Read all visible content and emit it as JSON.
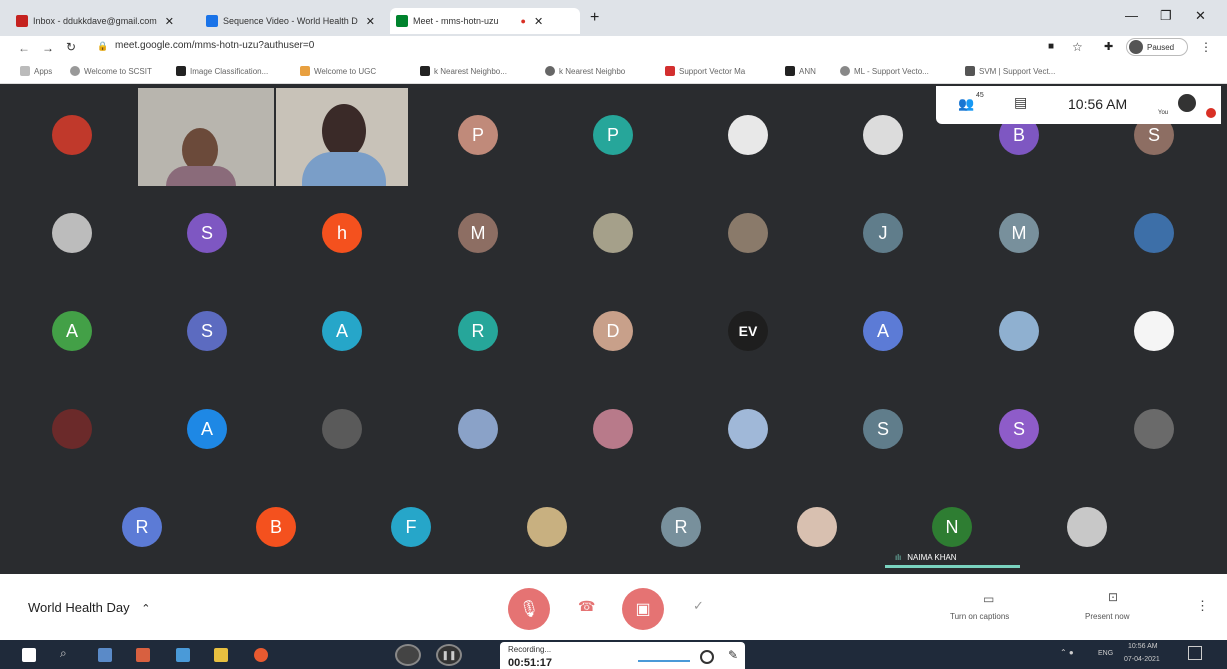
{
  "browser": {
    "tabs": [
      {
        "label": "Inbox - ddukkdave@gmail.com",
        "color": "#c5221f"
      },
      {
        "label": "Sequence Video - World Health D",
        "color": "#1a73e8"
      },
      {
        "label": "Meet - mms-hotn-uzu",
        "color": "#00832d"
      }
    ],
    "url": "meet.google.com/mms-hotn-uzu?authuser=0",
    "profile_label": "Paused",
    "bookmarks": [
      "Apps",
      "Welcome to SCSIT",
      "Image Classification...",
      "Welcome to UGC",
      "k Nearest Neighbo...",
      "k Nearest Neighbo",
      "Support Vector Ma",
      "ANN",
      "ML - Support Vecto...",
      "SVM | Support Vect..."
    ]
  },
  "meet": {
    "participant_count": "45",
    "time": "10:56 AM",
    "you_label": "You",
    "speaking_name": "NAIMA KHAN",
    "meeting_title": "World Health Day",
    "captions_label": "Turn on captions",
    "present_label": "Present now",
    "avatars": [
      {
        "letter": "",
        "color": "#c0392b"
      },
      {
        "letter": "P",
        "color": "#c08a7a"
      },
      {
        "letter": "P",
        "color": "#26a69a"
      },
      {
        "letter": "",
        "color": "#e8e8e8"
      },
      {
        "letter": "",
        "color": "#dcdcdc"
      },
      {
        "letter": "B",
        "color": "#7e57c2"
      },
      {
        "letter": "S",
        "color": "#8d6e63"
      },
      {
        "letter": "",
        "color": "#bcbcbc"
      },
      {
        "letter": "S",
        "color": "#7e57c2"
      },
      {
        "letter": "h",
        "color": "#f4511e"
      },
      {
        "letter": "M",
        "color": "#8d6e63"
      },
      {
        "letter": "",
        "color": "#a5a08a"
      },
      {
        "letter": "",
        "color": "#8a7a6a"
      },
      {
        "letter": "J",
        "color": "#607d8b"
      },
      {
        "letter": "M",
        "color": "#78909c"
      },
      {
        "letter": "",
        "color": "#3d6fa8"
      },
      {
        "letter": "A",
        "color": "#43a047"
      },
      {
        "letter": "S",
        "color": "#5c6bc0"
      },
      {
        "letter": "A",
        "color": "#26a6c9"
      },
      {
        "letter": "R",
        "color": "#26a69a"
      },
      {
        "letter": "D",
        "color": "#c8a08a"
      },
      {
        "letter": "EV",
        "color": "#1e1e1e"
      },
      {
        "letter": "A",
        "color": "#5c7bd6"
      },
      {
        "letter": "",
        "color": "#8fb0d0"
      },
      {
        "letter": "",
        "color": "#f5f5f5"
      },
      {
        "letter": "",
        "color": "#6b2a2a"
      },
      {
        "letter": "A",
        "color": "#1e88e5"
      },
      {
        "letter": "",
        "color": "#5a5a5a"
      },
      {
        "letter": "",
        "color": "#8aa2c8"
      },
      {
        "letter": "",
        "color": "#b87a8a"
      },
      {
        "letter": "",
        "color": "#a0b8d8"
      },
      {
        "letter": "S",
        "color": "#607d8b"
      },
      {
        "letter": "S",
        "color": "#8e5cc9"
      },
      {
        "letter": "",
        "color": "#6a6a6a"
      },
      {
        "letter": "R",
        "color": "#5c7bd6"
      },
      {
        "letter": "B",
        "color": "#f4511e"
      },
      {
        "letter": "F",
        "color": "#26a6c9"
      },
      {
        "letter": "",
        "color": "#c8b080"
      },
      {
        "letter": "R",
        "color": "#78909c"
      },
      {
        "letter": "",
        "color": "#d8c0b0"
      },
      {
        "letter": "N",
        "color": "#2e7d32"
      },
      {
        "letter": "",
        "color": "#c8c8c8"
      }
    ]
  },
  "recording": {
    "label": "Recording...",
    "time": "00:51:17"
  },
  "taskbar": {
    "lang": "ENG",
    "time": "10:56 AM",
    "date": "07-04-2021"
  }
}
